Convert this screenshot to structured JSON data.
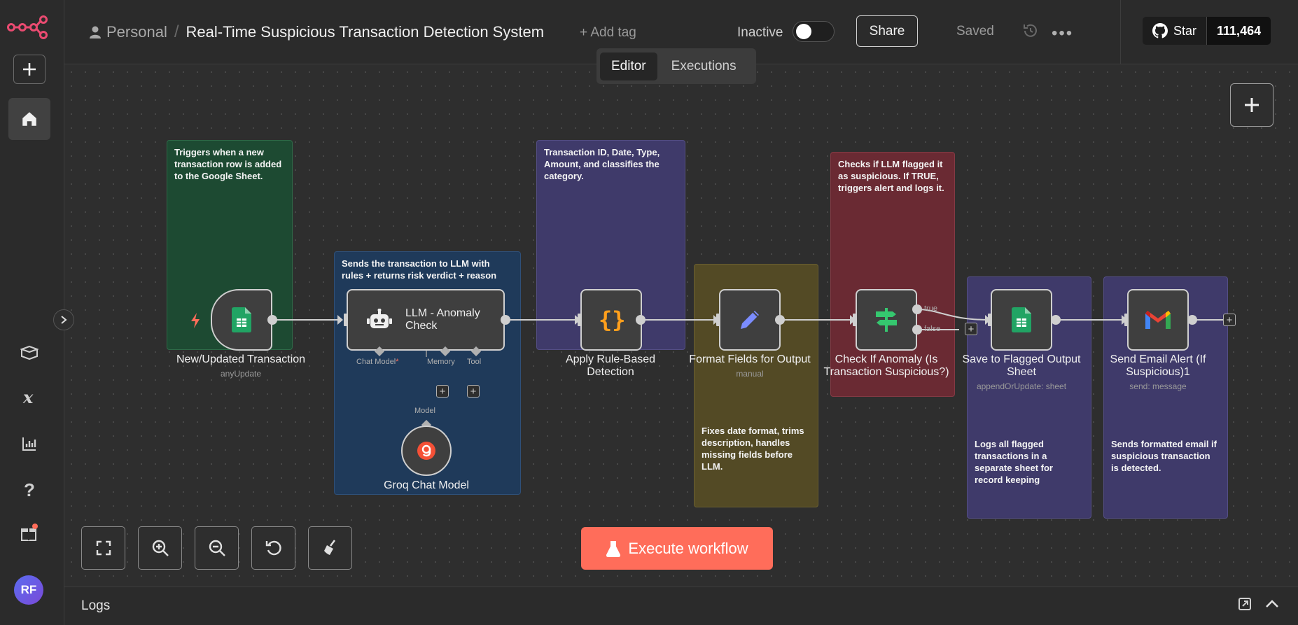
{
  "header": {
    "workspace": "Personal",
    "separator": "/",
    "workflow_title": "Real-Time Suspicious Transaction Detection System",
    "add_tag": "+ Add tag",
    "status_label": "Inactive",
    "share_label": "Share",
    "saved_label": "Saved",
    "more_label": "•••",
    "github": {
      "star_label": "Star",
      "star_count": "111,464"
    }
  },
  "tabs": [
    {
      "label": "Editor",
      "active": true
    },
    {
      "label": "Executions",
      "active": false
    }
  ],
  "sidebar": {
    "items": [
      "add",
      "home",
      "templates",
      "variables",
      "insights",
      "help",
      "whats-new"
    ],
    "avatar_initials": "RF"
  },
  "notes": {
    "trigger": "Triggers when a new transaction row is added to the Google Sheet.",
    "llm": "Sends the transaction to LLM with rules + returns risk verdict + reason",
    "rules": "Transaction ID, Date, Type, Amount, and classifies the category.",
    "format": "Fixes date format, trims description, handles missing fields before LLM.",
    "anomaly": "Checks if LLM flagged it as suspicious. If TRUE, triggers alert and logs it.",
    "save": "Logs all flagged transactions in a separate sheet for record keeping",
    "email": "Sends formatted email if suspicious transaction is detected."
  },
  "nodes": {
    "trigger": {
      "label": "New/Updated Transaction",
      "sub": "anyUpdate"
    },
    "llm": {
      "label": "LLM - Anomaly Check",
      "ports": {
        "chat_model": "Chat Model",
        "required_mark": "*",
        "memory": "Memory",
        "tool": "Tool"
      }
    },
    "groq": {
      "label": "Groq Chat Model",
      "port": "Model"
    },
    "rules": {
      "label": "Apply Rule-Based Detection"
    },
    "format": {
      "label": "Format Fields for Output",
      "sub": "manual"
    },
    "anomaly": {
      "label": "Check If Anomaly (Is Transaction Suspicious?)",
      "true_label": "true",
      "false_label": "false"
    },
    "save": {
      "label": "Save to Flagged Output Sheet",
      "sub": "appendOrUpdate: sheet"
    },
    "email": {
      "label": "Send Email Alert (If Suspicious)1",
      "sub": "send: message"
    }
  },
  "controls": {
    "execute_label": "Execute workflow"
  },
  "logs": {
    "title": "Logs"
  },
  "colors": {
    "accent": "#ff6d5a",
    "sheets_green": "#21a464",
    "code_orange": "#ff9f1c",
    "set_blue": "#7b8cff",
    "if_green": "#35c76f"
  }
}
